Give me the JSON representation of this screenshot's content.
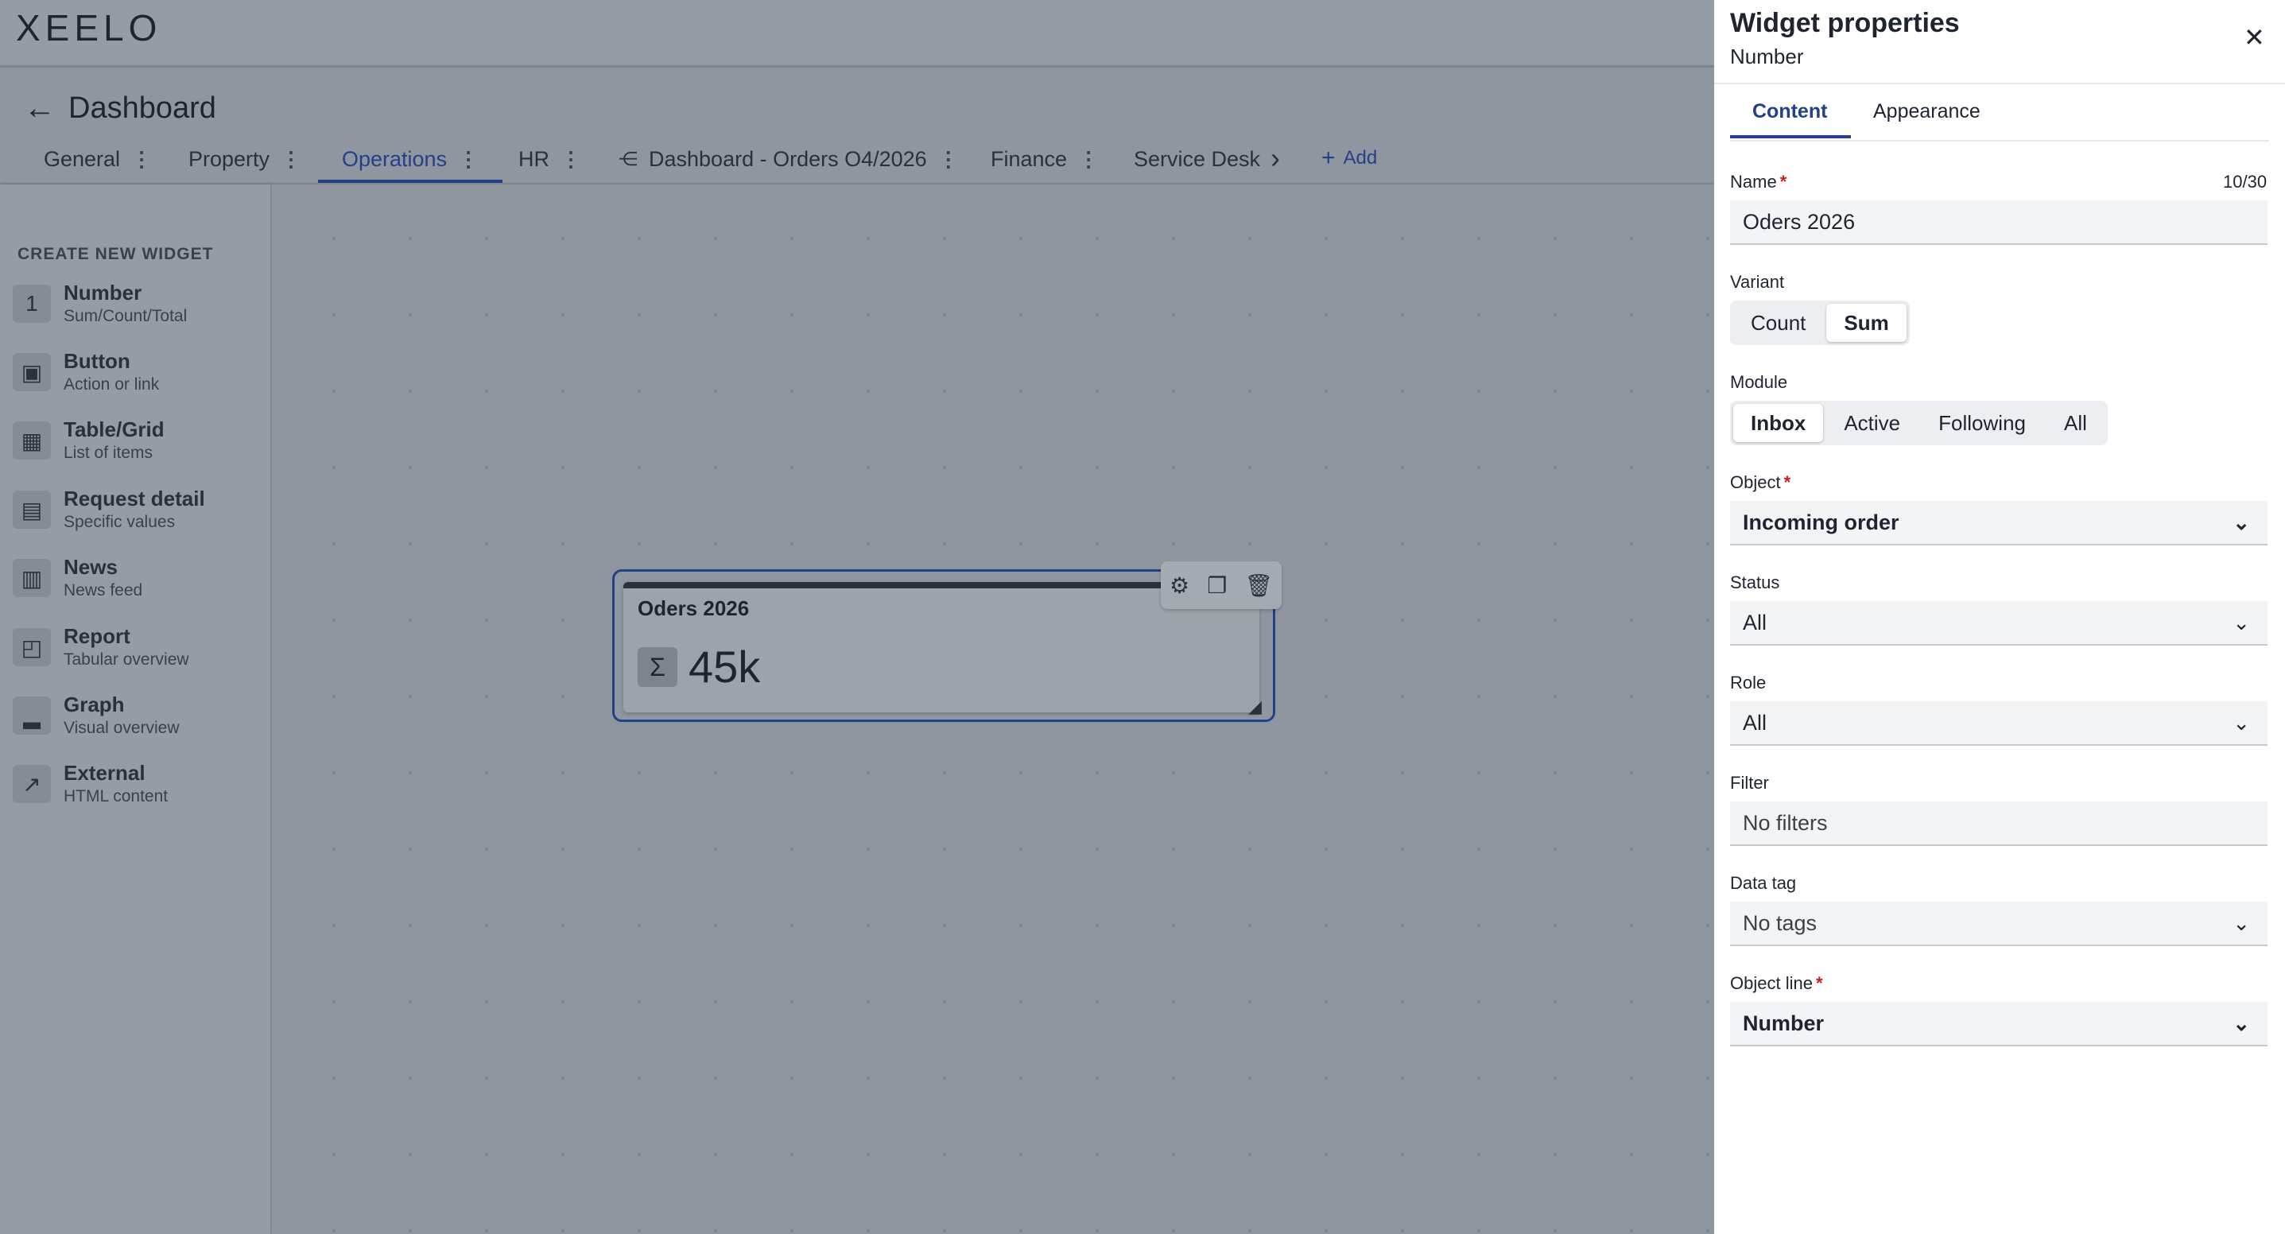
{
  "app": {
    "logo": "XEELO",
    "page_title": "Dashboard"
  },
  "tabs": [
    {
      "label": "General"
    },
    {
      "label": "Property"
    },
    {
      "label": "Operations"
    },
    {
      "label": "HR"
    },
    {
      "label": "Dashboard - Orders O4/2026"
    },
    {
      "label": "Finance"
    },
    {
      "label": "Service Desk"
    }
  ],
  "add_tab_label": "Add",
  "sidebar": {
    "heading": "CREATE NEW WIDGET",
    "items": [
      {
        "title": "Number",
        "subtitle": "Sum/Count/Total",
        "icon": "1"
      },
      {
        "title": "Button",
        "subtitle": "Action or link",
        "icon": "▣"
      },
      {
        "title": "Table/Grid",
        "subtitle": "List of items",
        "icon": "▦"
      },
      {
        "title": "Request detail",
        "subtitle": "Specific values",
        "icon": "▤"
      },
      {
        "title": "News",
        "subtitle": "News feed",
        "icon": "▥"
      },
      {
        "title": "Report",
        "subtitle": "Tabular overview",
        "icon": "◰"
      },
      {
        "title": "Graph",
        "subtitle": "Visual overview",
        "icon": "▂"
      },
      {
        "title": "External",
        "subtitle": "HTML content",
        "icon": "↗"
      }
    ]
  },
  "widget": {
    "title": "Oders 2026",
    "value": "45k",
    "icon": "Σ"
  },
  "panel": {
    "title": "Widget properties",
    "subtitle": "Number",
    "tabs": [
      "Content",
      "Appearance"
    ],
    "name_label": "Name",
    "name_counter": "10/30",
    "name_value": "Oders 2026",
    "variant_label": "Variant",
    "variant_options": [
      "Count",
      "Sum"
    ],
    "variant_selected": "Sum",
    "module_label": "Module",
    "module_options": [
      "Inbox",
      "Active",
      "Following",
      "All"
    ],
    "module_selected": "Inbox",
    "object_label": "Object",
    "object_value": "Incoming order",
    "status_label": "Status",
    "status_value": "All",
    "role_label": "Role",
    "role_value": "All",
    "filter_label": "Filter",
    "filter_value": "No filters",
    "datatag_label": "Data tag",
    "datatag_value": "No tags",
    "objectline_label": "Object line",
    "objectline_value": "Number",
    "required_mark": "*"
  },
  "colors": {
    "accent": "#25408a",
    "required": "#d11a1a",
    "overlay": "#8f969f"
  }
}
